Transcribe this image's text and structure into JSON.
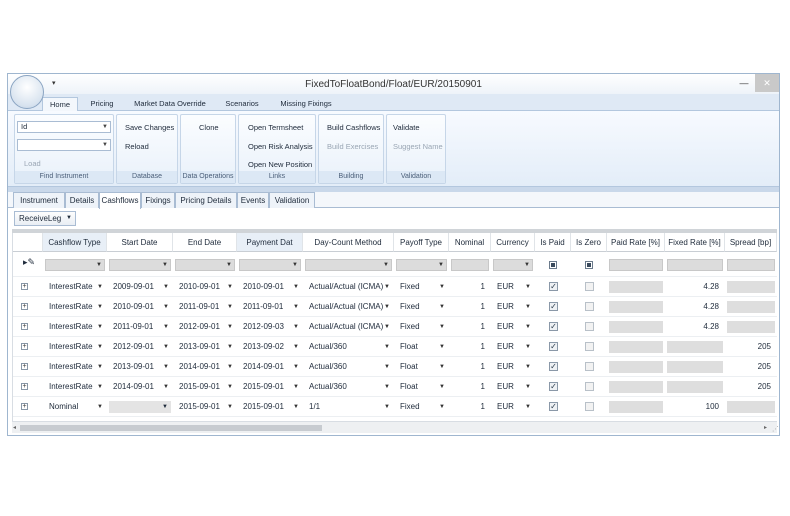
{
  "window": {
    "title": "FixedToFloatBond/Float/EUR/20150901",
    "qa_icon": "qat-dropdown-icon",
    "minimize": "—",
    "close": "✕"
  },
  "ribbon_tabs": [
    "Home",
    "Pricing",
    "Market Data Override",
    "Scenarios",
    "Missing Fixings"
  ],
  "ribbon": {
    "find_instrument": {
      "label": "Find Instrument",
      "id_combo": "Id",
      "value_combo": "",
      "load": "Load"
    },
    "database": {
      "label": "Database",
      "save": "Save Changes",
      "reload": "Reload"
    },
    "data_operations": {
      "label": "Data Operations",
      "clone": "Clone"
    },
    "links": {
      "label": "Links",
      "termsheet": "Open Termsheet",
      "risk": "Open Risk Analysis",
      "position": "Open New Position"
    },
    "building": {
      "label": "Building",
      "cashflows": "Build Cashflows",
      "exercises": "Build Exercises"
    },
    "validation": {
      "label": "Validation",
      "validate": "Validate",
      "suggest": "Suggest Name"
    }
  },
  "doc_tabs": [
    "Instrument",
    "Details",
    "Cashflows",
    "Fixings",
    "Pricing Details",
    "Events",
    "Validation"
  ],
  "active_doc_tab": "Cashflows",
  "toolbar": {
    "leg_selector": "ReceiveLeg"
  },
  "grid": {
    "columns": [
      "Cashflow Type",
      "Start Date",
      "End Date",
      "Payment Dat",
      "Day-Count Method",
      "Payoff Type",
      "Nominal",
      "Currency",
      "Is Paid",
      "Is Zero",
      "Paid Rate [%]",
      "Fixed Rate [%]",
      "Spread [bp]"
    ],
    "rows": [
      {
        "type": "InterestRate",
        "start": "2009-09-01",
        "end": "2010-09-01",
        "pay": "2010-09-01",
        "dcm": "Actual/Actual (ICMA)",
        "payoff": "Fixed",
        "nominal": "1",
        "ccy": "EUR",
        "paid": true,
        "zero": false,
        "fixed_rate": "4.28",
        "spread": ""
      },
      {
        "type": "InterestRate",
        "start": "2010-09-01",
        "end": "2011-09-01",
        "pay": "2011-09-01",
        "dcm": "Actual/Actual (ICMA)",
        "payoff": "Fixed",
        "nominal": "1",
        "ccy": "EUR",
        "paid": true,
        "zero": false,
        "fixed_rate": "4.28",
        "spread": ""
      },
      {
        "type": "InterestRate",
        "start": "2011-09-01",
        "end": "2012-09-01",
        "pay": "2012-09-03",
        "dcm": "Actual/Actual (ICMA)",
        "payoff": "Fixed",
        "nominal": "1",
        "ccy": "EUR",
        "paid": true,
        "zero": false,
        "fixed_rate": "4.28",
        "spread": ""
      },
      {
        "type": "InterestRate",
        "start": "2012-09-01",
        "end": "2013-09-01",
        "pay": "2013-09-02",
        "dcm": "Actual/360",
        "payoff": "Float",
        "nominal": "1",
        "ccy": "EUR",
        "paid": true,
        "zero": false,
        "fixed_rate": "",
        "spread": "205"
      },
      {
        "type": "InterestRate",
        "start": "2013-09-01",
        "end": "2014-09-01",
        "pay": "2014-09-01",
        "dcm": "Actual/360",
        "payoff": "Float",
        "nominal": "1",
        "ccy": "EUR",
        "paid": true,
        "zero": false,
        "fixed_rate": "",
        "spread": "205"
      },
      {
        "type": "InterestRate",
        "start": "2014-09-01",
        "end": "2015-09-01",
        "pay": "2015-09-01",
        "dcm": "Actual/360",
        "payoff": "Float",
        "nominal": "1",
        "ccy": "EUR",
        "paid": true,
        "zero": false,
        "fixed_rate": "",
        "spread": "205"
      },
      {
        "type": "Nominal",
        "start": "",
        "end": "2015-09-01",
        "pay": "2015-09-01",
        "dcm": "1/1",
        "payoff": "Fixed",
        "nominal": "1",
        "ccy": "EUR",
        "paid": true,
        "zero": false,
        "fixed_rate": "100",
        "spread": ""
      }
    ]
  }
}
